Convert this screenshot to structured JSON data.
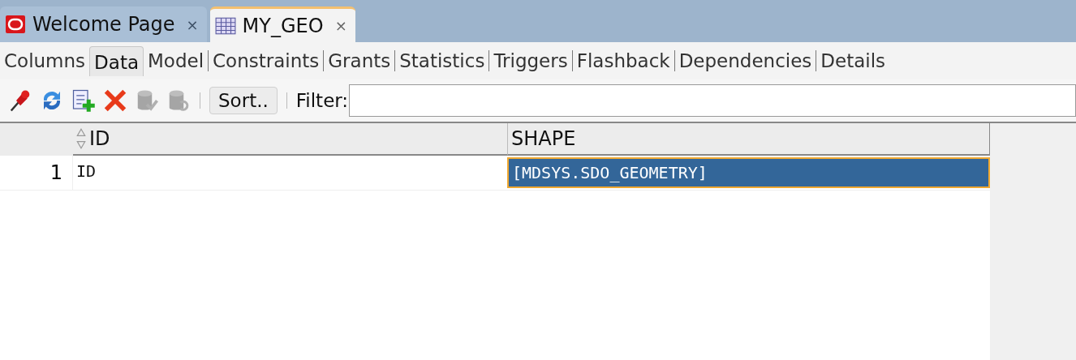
{
  "editor_tabs": [
    {
      "label": "Welcome Page",
      "kind": "welcome",
      "selected": false,
      "close": "×"
    },
    {
      "label": "MY_GEO",
      "kind": "table",
      "selected": true,
      "close": "×"
    }
  ],
  "sub_tabs": [
    {
      "label": "Columns",
      "selected": false
    },
    {
      "label": "Data",
      "selected": true
    },
    {
      "label": "Model",
      "selected": false
    },
    {
      "label": "Constraints",
      "selected": false
    },
    {
      "label": "Grants",
      "selected": false
    },
    {
      "label": "Statistics",
      "selected": false
    },
    {
      "label": "Triggers",
      "selected": false
    },
    {
      "label": "Flashback",
      "selected": false
    },
    {
      "label": "Dependencies",
      "selected": false
    },
    {
      "label": "Details",
      "selected": false
    }
  ],
  "toolbar": {
    "tools": [
      {
        "kind": "pin",
        "disabled": false
      },
      {
        "kind": "refresh",
        "disabled": false
      },
      {
        "kind": "insert",
        "disabled": false
      },
      {
        "kind": "delete",
        "disabled": false
      },
      {
        "kind": "commit",
        "disabled": true
      },
      {
        "kind": "rollback",
        "disabled": true
      }
    ],
    "sort_button": "Sort..",
    "filter_label": "Filter:"
  },
  "table": {
    "columns": [
      "ID",
      "SHAPE"
    ],
    "rows": [
      {
        "number": "1",
        "cells": [
          {
            "text": "ID",
            "selected": false
          },
          {
            "text": "[MDSYS.SDO_GEOMETRY]",
            "selected": true
          }
        ]
      }
    ]
  }
}
